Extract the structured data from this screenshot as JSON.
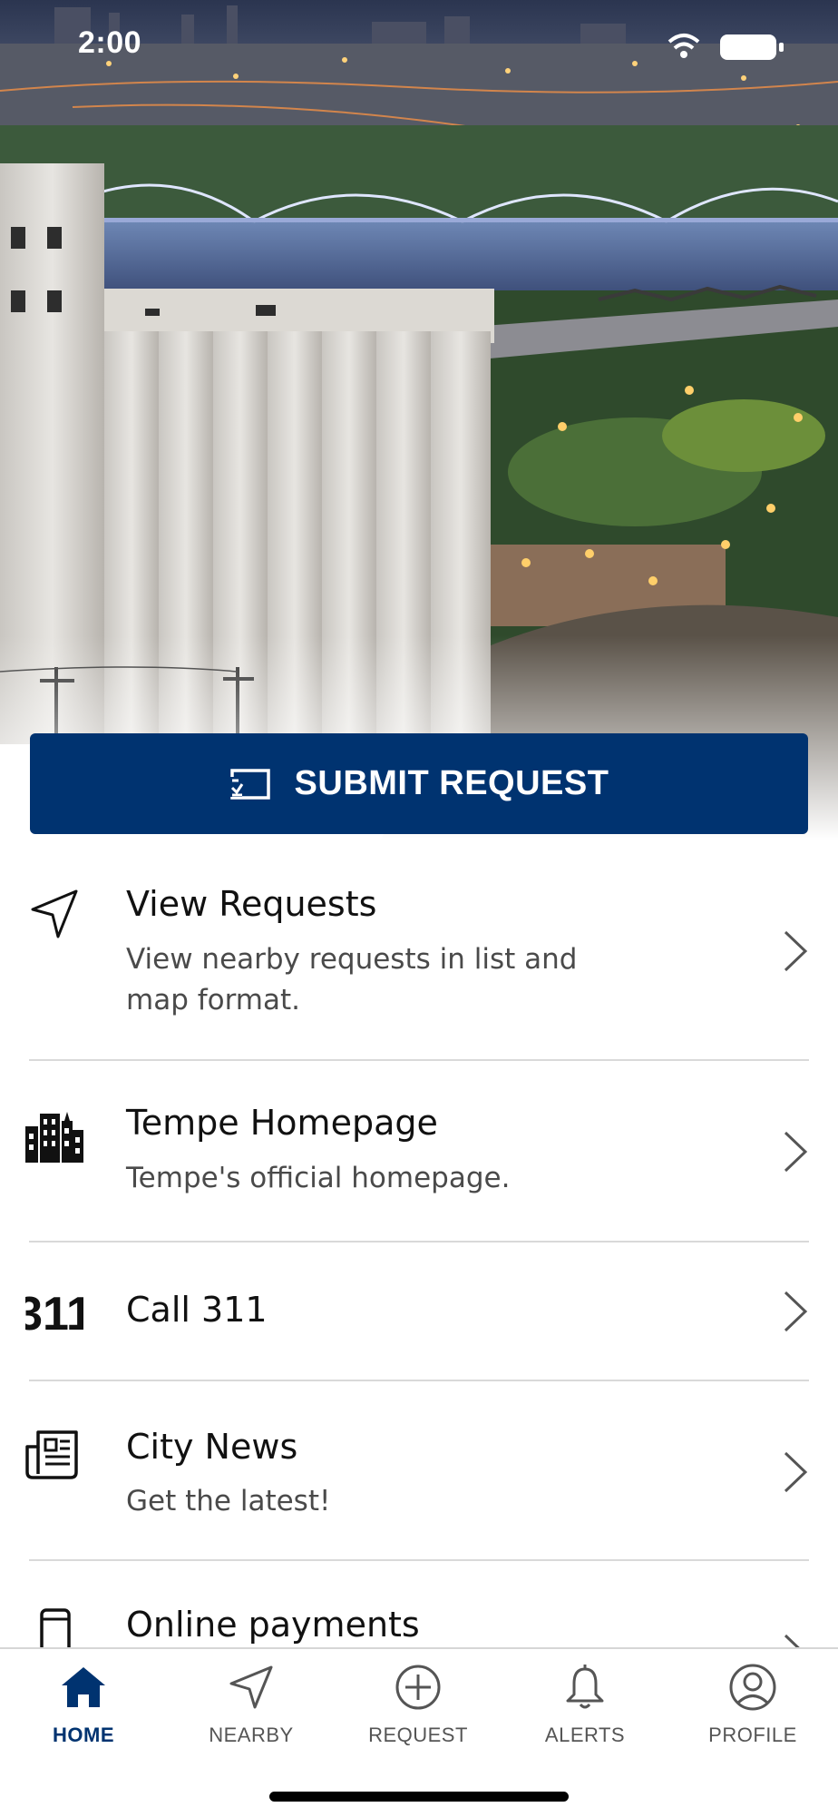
{
  "status_bar": {
    "time": "2:00"
  },
  "submit": {
    "label": "SUBMIT REQUEST",
    "icon": "report-screen-icon"
  },
  "menu": {
    "items": [
      {
        "title": "View Requests",
        "subtitle": "View nearby requests in list and map format.",
        "icon": "send-arrow-icon"
      },
      {
        "title": "Tempe Homepage",
        "subtitle": "Tempe's official homepage.",
        "icon": "city-buildings-icon"
      },
      {
        "title": "Call 311",
        "subtitle": "",
        "icon": "311-icon",
        "icon_text": "311"
      },
      {
        "title": "City News",
        "subtitle": "Get the latest!",
        "icon": "newspaper-icon"
      },
      {
        "title": "Online payments",
        "subtitle": "",
        "icon": "phone-icon"
      }
    ]
  },
  "bottom_nav": {
    "tabs": [
      {
        "label": "HOME",
        "icon": "home-icon",
        "active": true
      },
      {
        "label": "NEARBY",
        "icon": "navigation-icon",
        "active": false
      },
      {
        "label": "REQUEST",
        "icon": "plus-circle-icon",
        "active": false
      },
      {
        "label": "ALERTS",
        "icon": "bell-icon",
        "active": false
      },
      {
        "label": "PROFILE",
        "icon": "user-circle-icon",
        "active": false
      }
    ]
  },
  "colors": {
    "primary": "#003370",
    "divider": "#d9d9d9",
    "text": "#111111",
    "muted": "#4a4a4a"
  }
}
